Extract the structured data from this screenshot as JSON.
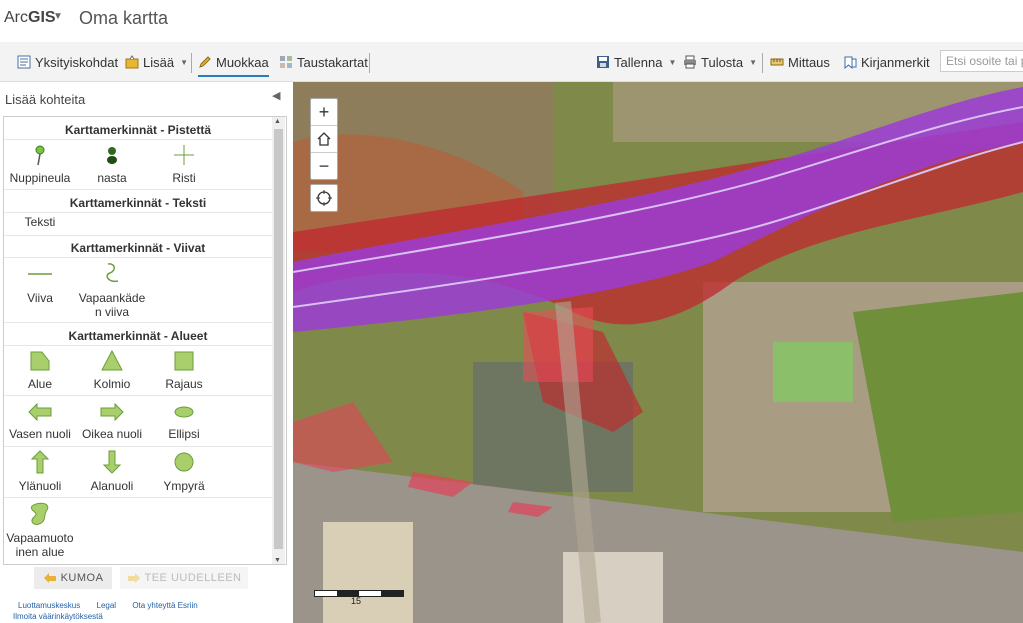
{
  "header": {
    "brand_regular": "Arc",
    "brand_bold": "GIS",
    "map_title": "Oma kartta"
  },
  "toolbar": {
    "details": "Yksityiskohdat",
    "add": "Lisää",
    "edit": "Muokkaa",
    "basemaps": "Taustakartat",
    "save": "Tallenna",
    "print": "Tulosta",
    "measure": "Mittaus",
    "bookmarks": "Kirjanmerkit",
    "search_placeholder": "Etsi osoite tai paikka"
  },
  "panel": {
    "title": "Lisää kohteita",
    "categories": {
      "points": "Karttamerkinnät - Pistettä",
      "text": "Karttamerkinnät - Teksti",
      "lines": "Karttamerkinnät - Viivat",
      "areas": "Karttamerkinnät - Alueet"
    },
    "items": {
      "pin": "Nuppineula",
      "stud": "nasta",
      "cross": "Risti",
      "text": "Teksti",
      "line": "Viiva",
      "freehand_line": "Vapaankäde n viiva",
      "area": "Alue",
      "triangle": "Kolmio",
      "boundary": "Rajaus",
      "left_arrow": "Vasen nuoli",
      "right_arrow": "Oikea nuoli",
      "ellipse": "Ellipsi",
      "up_arrow": "Ylänuoli",
      "down_arrow": "Alanuoli",
      "circle": "Ympyrä",
      "freeform_area": "Vapaamuoto inen alue"
    },
    "undo": "KUMOA",
    "redo": "TEE UUDELLEEN"
  },
  "footer": {
    "trust": "Luottamuskeskus",
    "legal": "Legal",
    "contact": "Ota yhteyttä Esriin",
    "report": "Ilmoita väärinkäytöksestä"
  },
  "map": {
    "zoom_in": "+",
    "zoom_out": "−",
    "scale_label": "15"
  },
  "colors": {
    "accent": "#2b7bbb",
    "highway_overlay": "#9b3cd6",
    "risk_overlay": "#d9262a",
    "light_overlay": "#ef4b5a"
  }
}
